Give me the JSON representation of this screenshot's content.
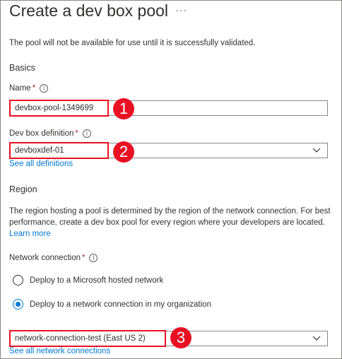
{
  "header": {
    "title": "Create a dev box pool",
    "more_label": "···"
  },
  "intro": {
    "text": "The pool will not be available for use until it is successfully validated."
  },
  "basics": {
    "heading": "Basics",
    "name": {
      "label": "Name",
      "required": "*",
      "info": "i",
      "value": "devbox-pool-1349699"
    },
    "definition": {
      "label": "Dev box definition",
      "required": "*",
      "info": "i",
      "value": "devboxdef-01",
      "link": "See all definitions"
    }
  },
  "region": {
    "heading": "Region",
    "description": "The region hosting a pool is determined by the region of the network connection. For best performance, create a dev box pool for every region where your developers are located.",
    "learn_more": "Learn more",
    "network": {
      "label": "Network connection",
      "required": "*",
      "info": "i",
      "options": [
        {
          "label": "Deploy to a Microsoft hosted network",
          "selected": false
        },
        {
          "label": "Deploy to a network connection in my organization",
          "selected": true
        }
      ],
      "value": "network-connection-test (East US 2)",
      "link": "See all network connections"
    }
  },
  "callouts": [
    "1",
    "2",
    "3"
  ],
  "colors": {
    "accent": "#0078d4",
    "callout": "#e81123",
    "border": "#8a8886"
  }
}
